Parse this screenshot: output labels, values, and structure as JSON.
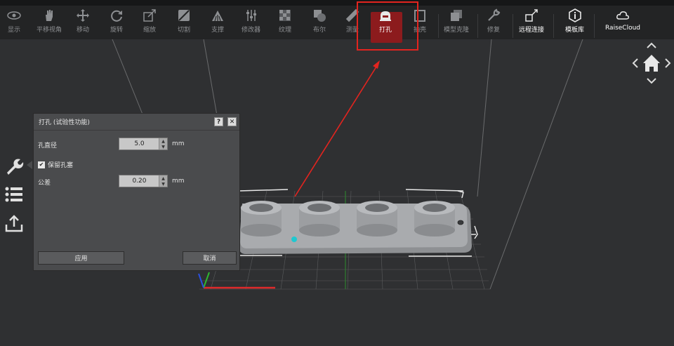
{
  "toolbar": {
    "items": [
      {
        "label": "显示",
        "icon": "eye-icon"
      },
      {
        "label": "平移视角",
        "icon": "hand-icon"
      },
      {
        "label": "移动",
        "icon": "move-icon"
      },
      {
        "label": "旋转",
        "icon": "rotate-icon"
      },
      {
        "label": "缩放",
        "icon": "scale-icon"
      },
      {
        "label": "切割",
        "icon": "cut-icon"
      },
      {
        "label": "支撑",
        "icon": "support-icon"
      },
      {
        "label": "修改器",
        "icon": "modifier-icon"
      },
      {
        "label": "纹理",
        "icon": "texture-icon"
      },
      {
        "label": "布尔",
        "icon": "boolean-icon"
      },
      {
        "label": "测量",
        "icon": "measure-icon"
      },
      {
        "label": "打孔",
        "icon": "punch-hole-icon"
      },
      {
        "label": "抽壳",
        "icon": "hollow-icon"
      },
      {
        "label": "模型克隆",
        "icon": "clone-icon"
      },
      {
        "label": "修复",
        "icon": "repair-icon"
      },
      {
        "label": "远程连接",
        "icon": "remote-connect-icon"
      },
      {
        "label": "模板库",
        "icon": "info-icon"
      },
      {
        "label": "RaiseCloud",
        "icon": "cloud-icon"
      }
    ],
    "active_item": "打孔",
    "active_color": "#8c1b1d",
    "highlight_color": "#e3241f"
  },
  "side_panel": {
    "icons": [
      "wrench-icon",
      "list-icon",
      "upload-icon"
    ]
  },
  "dialog": {
    "title": "打孔 (试验性功能)",
    "help_label": "?",
    "close_label": "✕",
    "hole_diameter_label": "孔直径",
    "hole_diameter_value": "5.0",
    "hole_diameter_unit": "mm",
    "keep_plug_label": "保留孔塞",
    "keep_plug_checked": "✔",
    "tolerance_label": "公差",
    "tolerance_value": "0.20",
    "tolerance_unit": "mm",
    "apply_label": "应用",
    "cancel_label": "取消"
  },
  "colors": {
    "background": "#2f3032",
    "toolbar": "#232425",
    "model": "#a9abae",
    "annotation_arrow": "#e3241f"
  }
}
